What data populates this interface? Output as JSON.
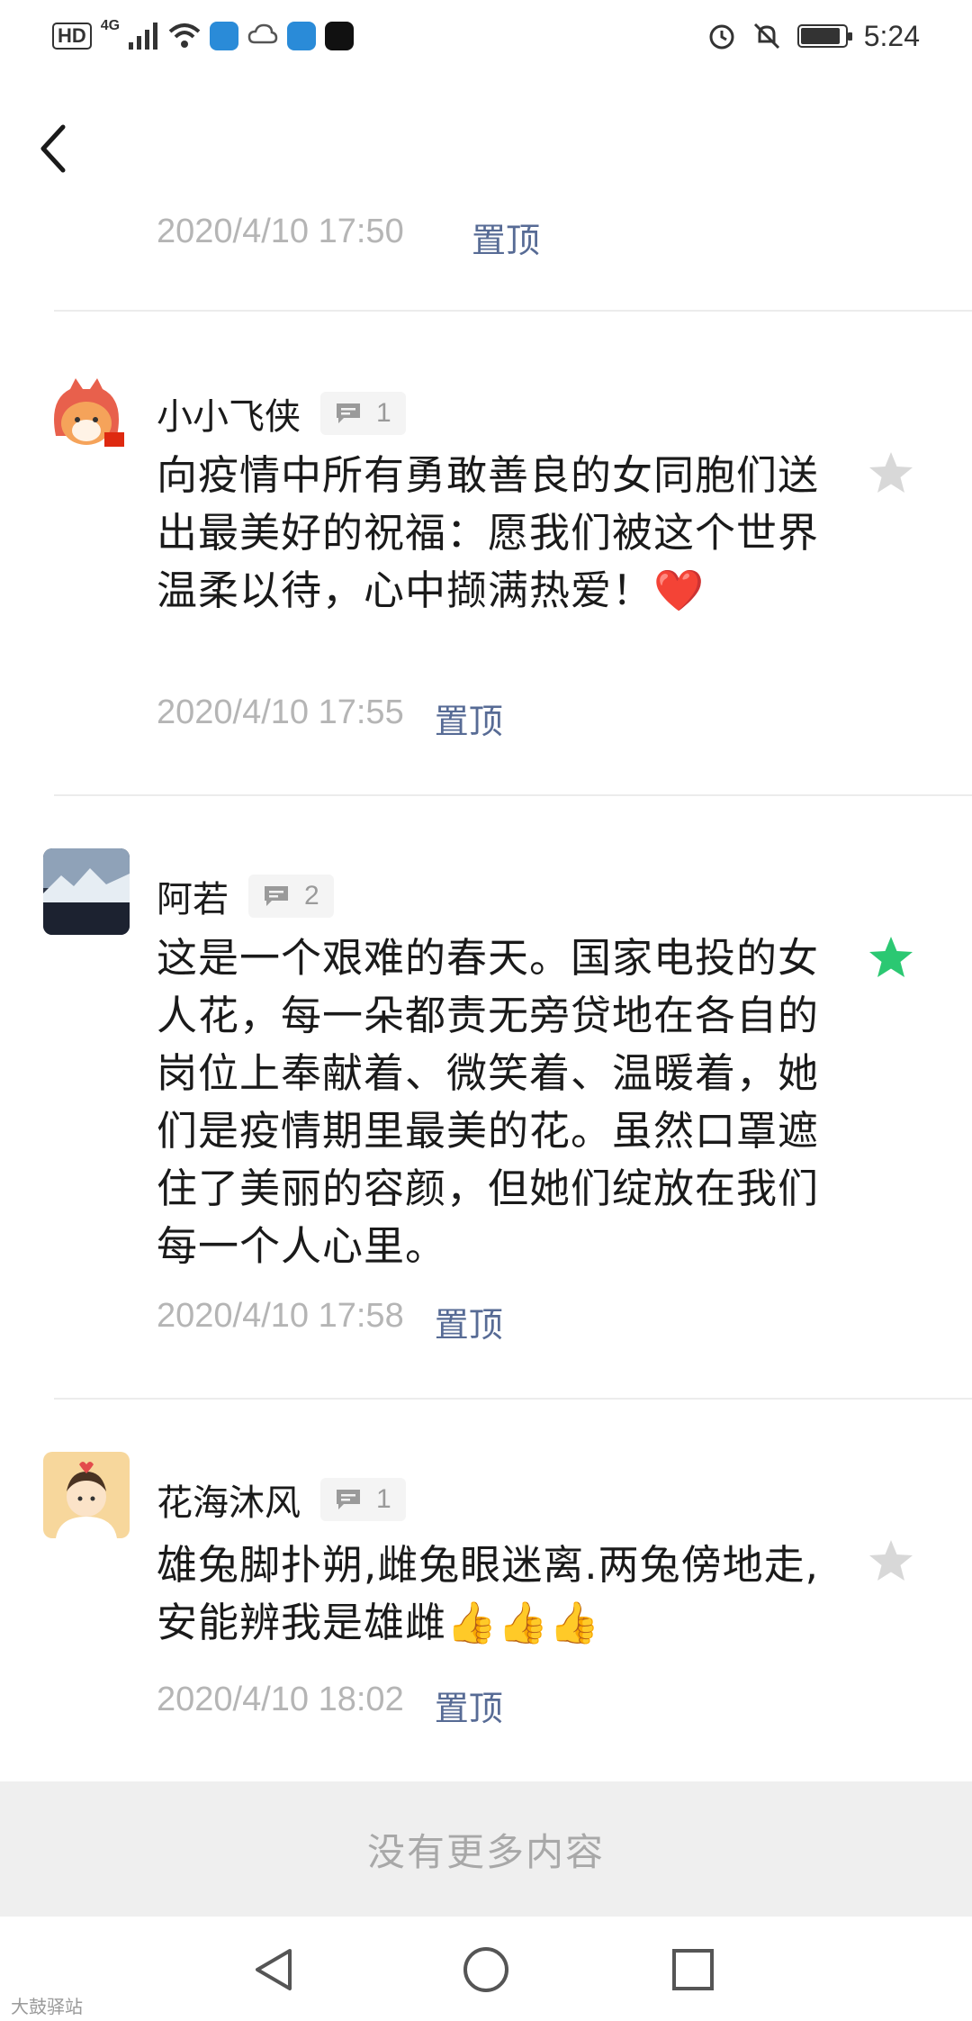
{
  "status_bar": {
    "hd": "HD",
    "network": "4G",
    "time": "5:24",
    "battery_level": 0.9
  },
  "clipped_top": {
    "time": "2020/4/10 17:50",
    "pin_label": "置顶"
  },
  "comments": [
    {
      "name": "小小飞侠",
      "reply_count": "1",
      "text": "向疫情中所有勇敢善良的女同胞们送出最美好的祝福：愿我们被这个世界温柔以待，心中撷满热爱！❤️",
      "time": "2020/4/10 17:55",
      "pin_label": "置顶",
      "starred": false
    },
    {
      "name": "阿若",
      "reply_count": "2",
      "text": "这是一个艰难的春天。国家电投的女人花，每一朵都责无旁贷地在各自的岗位上奉献着、微笑着、温暖着，她们是疫情期里最美的花。虽然口罩遮住了美丽的容颜，但她们绽放在我们每一个人心里。",
      "time": "2020/4/10 17:58",
      "pin_label": "置顶",
      "starred": true
    },
    {
      "name": "花海沐风",
      "reply_count": "1",
      "text": "雄兔脚扑朔,雌兔眼迷离.两兔傍地走,安能辨我是雄雌👍👍👍",
      "time": "2020/4/10 18:02",
      "pin_label": "置顶",
      "starred": false
    }
  ],
  "footer": {
    "no_more": "没有更多内容"
  },
  "watermark": "大鼓驿站",
  "colors": {
    "star_active": "#2bc872",
    "star_inactive": "#d8d8d8",
    "pin": "#576b95",
    "timestamp": "#b5b5b5"
  }
}
